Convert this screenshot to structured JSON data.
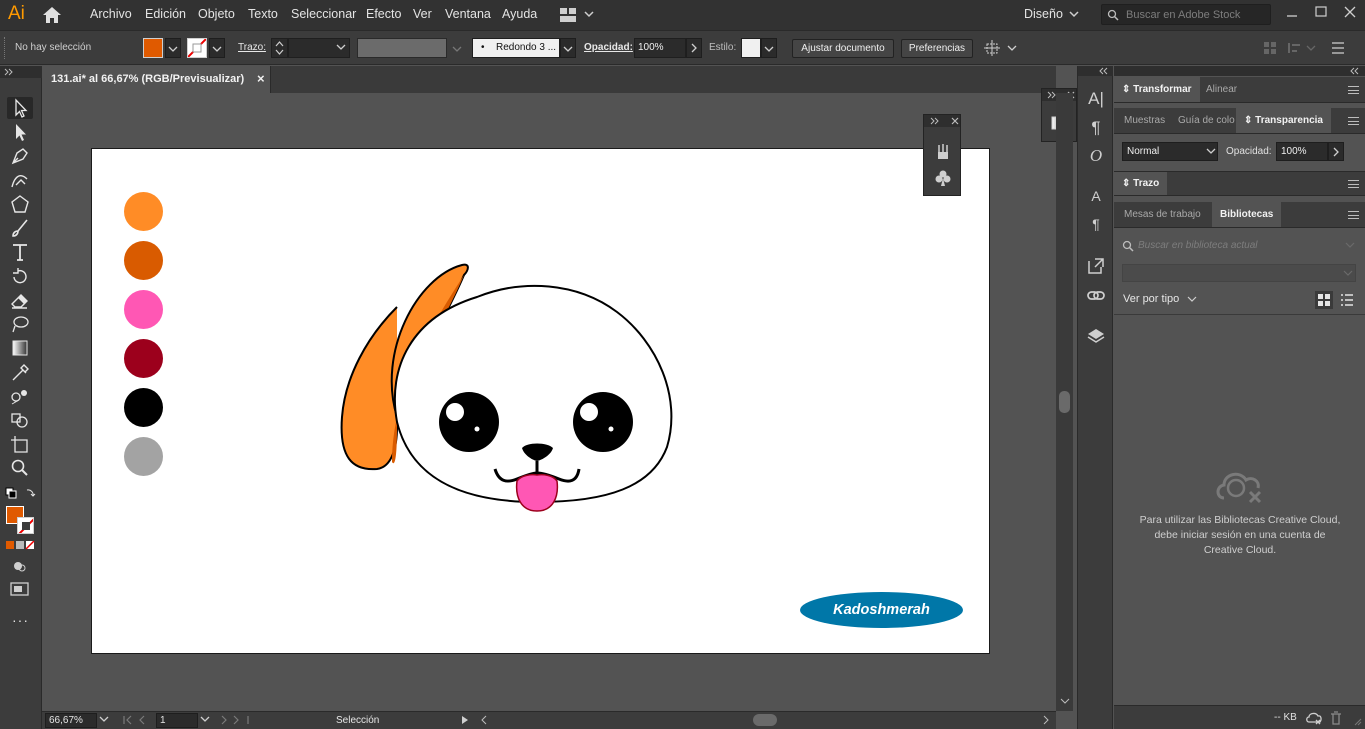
{
  "app": {
    "logo": "Ai",
    "workspace": "Diseño",
    "stock_placeholder": "Buscar en Adobe Stock"
  },
  "menu": [
    "Archivo",
    "Edición",
    "Objeto",
    "Texto",
    "Seleccionar",
    "Efecto",
    "Ver",
    "Ventana",
    "Ayuda"
  ],
  "control": {
    "selection_status": "No hay selección",
    "stroke_label": "Trazo:",
    "brush_label": "Redondo 3 ...",
    "opacity_label": "Opacidad:",
    "opacity_value": "100%",
    "style_label": "Estilo:",
    "fit_doc_button": "Ajustar documento",
    "prefs_button": "Preferencias",
    "fill_color": "#e05a00"
  },
  "document": {
    "tab_title": "131.ai* al 66,67% (RGB/Previsualizar)",
    "close": "×"
  },
  "artboard": {
    "swatches": [
      "#ff8c26",
      "#d95b00",
      "#ff57b4",
      "#9c001c",
      "#000000",
      "#a3a3a3"
    ],
    "brand_text": "Kadoshmerah"
  },
  "status": {
    "zoom": "66,67%",
    "page": "1",
    "tool": "Selección"
  },
  "panels": {
    "transform_tabs": [
      "Transformar",
      "Alinear"
    ],
    "transparency_tabs": [
      "Muestras",
      "Guía de colo",
      "Transparencia"
    ],
    "blend_mode": "Normal",
    "opacity_label": "Opacidad:",
    "opacity_value": "100%",
    "stroke_title": "Trazo",
    "library_tabs": [
      "Mesas de trabajo",
      "Bibliotecas"
    ],
    "library_search_placeholder": "Buscar en biblioteca actual",
    "view_by": "Ver por tipo",
    "cc_message": "Para utilizar las Bibliotecas Creative Cloud, debe iniciar sesión en una cuenta de Creative Cloud.",
    "kb": "-- KB"
  }
}
